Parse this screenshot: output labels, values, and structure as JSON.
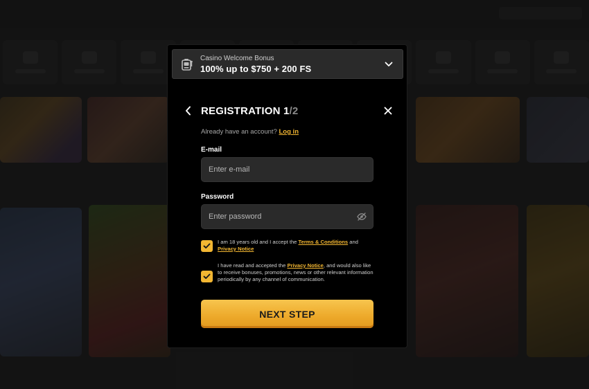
{
  "bonus": {
    "label": "Casino Welcome Bonus",
    "value": "100% up to $750 + 200 FS",
    "icon": "slot-machine-icon"
  },
  "registration": {
    "title": "REGISTRATION 1",
    "title_step_total": "/2",
    "already_text": "Already have an account?",
    "login_link": "Log in"
  },
  "email": {
    "label": "E-mail",
    "placeholder": "Enter e-mail",
    "value": ""
  },
  "password": {
    "label": "Password",
    "placeholder": "Enter password",
    "value": ""
  },
  "consent_age": {
    "checked": true,
    "text_before": "I am 18 years old and I accept the",
    "terms_link": "Terms & Conditions",
    "text_and": "and",
    "privacy_link": "Privacy Notice"
  },
  "consent_marketing": {
    "checked": true,
    "text_before": "I have read and accepted the",
    "privacy_link": "Privacy Notice",
    "text_after": ", and would also like to receive bonuses, promotions, news or other relevant information periodically by any channel of communication."
  },
  "next_button": "NEXT STEP",
  "colors": {
    "accent": "#f2b632",
    "modal_bg": "#000000",
    "input_bg": "#2a2a2a"
  }
}
